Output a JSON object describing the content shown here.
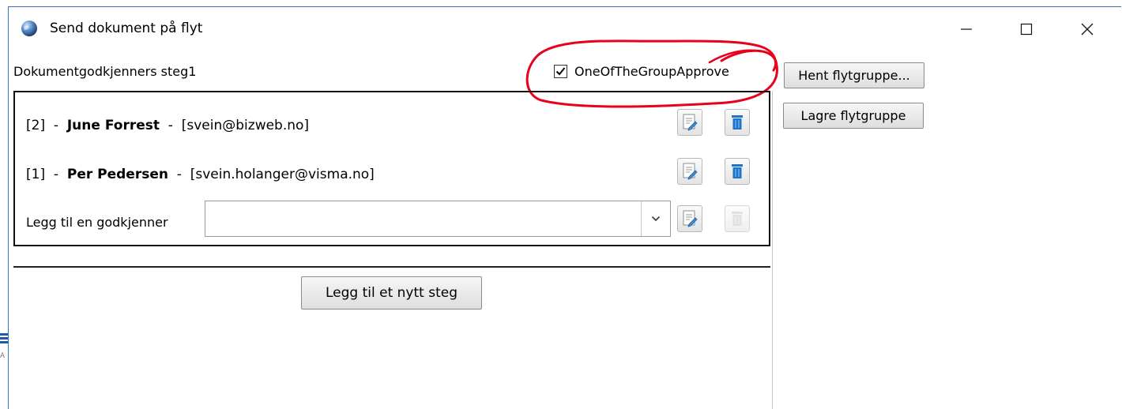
{
  "window": {
    "title": "Send dokument på flyt",
    "controls": {
      "minimize": "minimize-icon",
      "maximize": "maximize-icon",
      "close": "close-icon"
    }
  },
  "step": {
    "label": "Dokumentgodkjenners steg1",
    "checkbox": {
      "label": "OneOfTheGroupApprove",
      "checked": true
    }
  },
  "side_buttons": {
    "hent": "Hent flytgruppe...",
    "lagre": "Lagre flytgruppe"
  },
  "approvers": [
    {
      "order": "[2]",
      "sep1": "-",
      "name": "June Forrest",
      "sep2": "-",
      "email": "[svein@bizweb.no]"
    },
    {
      "order": "[1]",
      "sep1": "-",
      "name": "Per Pedersen",
      "sep2": "-",
      "email": "[svein.holanger@visma.no]"
    }
  ],
  "add_approver": {
    "label": "Legg til en godkjenner",
    "value": ""
  },
  "new_step_button": "Legg til et nytt steg",
  "background_app": {
    "text": "A"
  },
  "colors": {
    "window_border": "#2d73c7",
    "annotation_red": "#e8001c",
    "trash_blue": "#1f73c9"
  }
}
